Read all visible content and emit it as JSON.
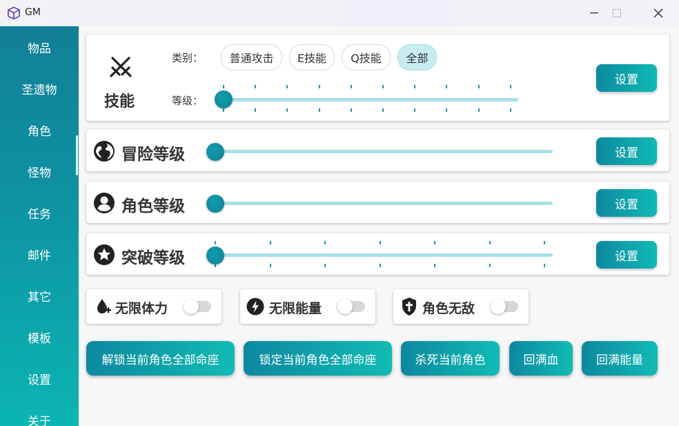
{
  "window": {
    "title": "GM",
    "icons": {
      "app": "cube-icon",
      "minimize": "minimize-icon",
      "maximize": "maximize-icon",
      "close": "close-icon"
    }
  },
  "sidebar": {
    "items": [
      {
        "label": "物品"
      },
      {
        "label": "圣遗物"
      },
      {
        "label": "角色",
        "selected": true
      },
      {
        "label": "怪物"
      },
      {
        "label": "任务"
      },
      {
        "label": "邮件"
      },
      {
        "label": "其它"
      },
      {
        "label": "模板"
      },
      {
        "label": "设置"
      },
      {
        "label": "关于"
      }
    ]
  },
  "skill": {
    "title": "技能",
    "icon": "crossed-swords-icon",
    "category_label": "类别：",
    "categories": [
      {
        "label": "普通攻击",
        "selected": false
      },
      {
        "label": "E技能",
        "selected": false
      },
      {
        "label": "Q技能",
        "selected": false
      },
      {
        "label": "全部",
        "selected": true
      }
    ],
    "level_label": "等级：",
    "level_slider_fraction": 0.0,
    "set_label": "设置"
  },
  "adventure": {
    "label": "冒险等级",
    "icon": "globe-icon",
    "slider_fraction": 0.0,
    "set_label": "设置"
  },
  "character": {
    "label": "角色等级",
    "icon": "user-circle-icon",
    "slider_fraction": 0.0,
    "set_label": "设置"
  },
  "breakthrough": {
    "label": "突破等级",
    "icon": "star-circle-icon",
    "slider_fraction": 0.0,
    "set_label": "设置"
  },
  "toggles": [
    {
      "label": "无限体力",
      "icon": "drop-plus-icon",
      "on": false
    },
    {
      "label": "无限能量",
      "icon": "lightning-circle-icon",
      "on": false
    },
    {
      "label": "角色无敌",
      "icon": "shield-cross-icon",
      "on": false
    }
  ],
  "actions": [
    {
      "label": "解锁当前角色全部命座"
    },
    {
      "label": "锁定当前角色全部命座"
    },
    {
      "label": "杀死当前角色"
    },
    {
      "label": "回满血"
    },
    {
      "label": "回满能量"
    }
  ],
  "colors": {
    "accent_dark": "#0d88a0",
    "accent_light": "#11bbb4",
    "track": "#a6dfe5",
    "chip_active": "#c6ecf0"
  }
}
